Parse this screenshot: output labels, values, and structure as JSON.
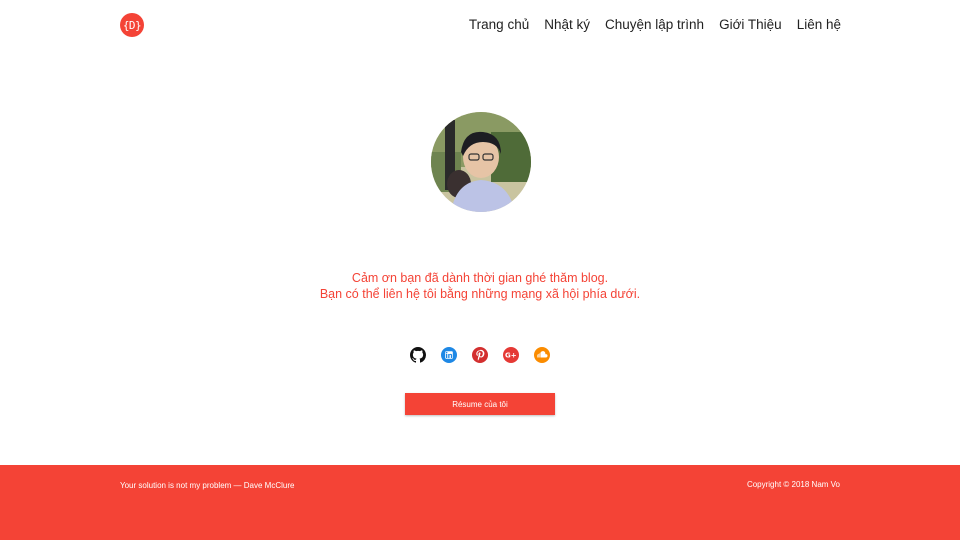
{
  "header": {
    "logo_text": "{D}",
    "nav": [
      {
        "label": "Trang chủ"
      },
      {
        "label": "Nhật ký"
      },
      {
        "label": "Chuyện lập trình"
      },
      {
        "label": "Giới Thiệu"
      },
      {
        "label": "Liên hệ"
      }
    ]
  },
  "main": {
    "message_line1": "Cảm ơn bạn đã dành thời gian ghé thăm blog.",
    "message_line2": "Bạn có thể liên hệ tôi bằng những mạng xã hội phía dưới.",
    "social_icons": [
      "github-icon",
      "linkedin-icon",
      "pinterest-icon",
      "google-plus-icon",
      "soundcloud-icon"
    ],
    "resume_label": "Résume của tôi"
  },
  "footer": {
    "quote": "Your solution is not my problem — Dave McClure",
    "copyright": "Copyright © 2018 Nam Vo"
  },
  "colors": {
    "accent": "#f44336",
    "github": "#111111",
    "linkedin": "#1e88e5",
    "pinterest": "#d32f2f",
    "google_plus": "#e53935",
    "soundcloud": "#fb8c00"
  }
}
